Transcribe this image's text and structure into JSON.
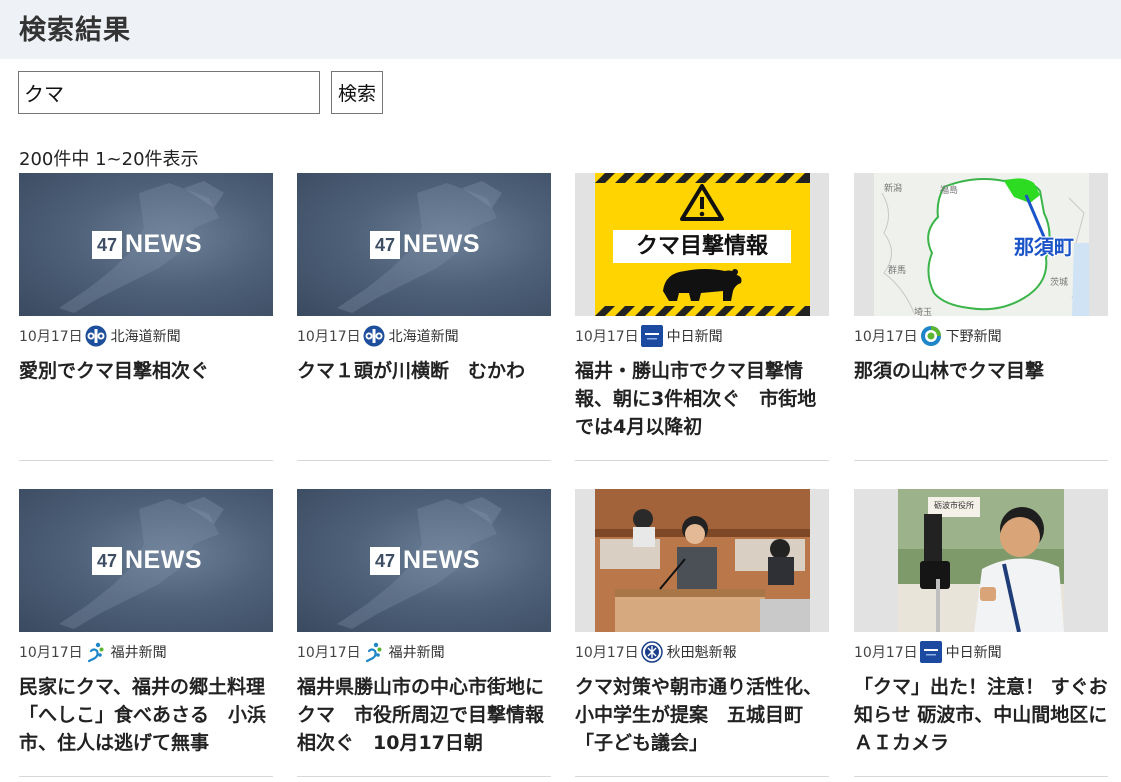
{
  "page": {
    "title": "検索結果"
  },
  "search": {
    "value": "クマ",
    "button_label": "検索"
  },
  "results": {
    "count_text": "200件中 1~20件表示",
    "items": [
      {
        "date": "10月17日",
        "source": "北海道新聞",
        "title": "愛別でクマ目撃相次ぐ",
        "thumb": "47news"
      },
      {
        "date": "10月17日",
        "source": "北海道新聞",
        "title": "クマ１頭が川横断　むかわ",
        "thumb": "47news"
      },
      {
        "date": "10月17日",
        "source": "中日新聞",
        "title": "福井・勝山市でクマ目撃情報、朝に3件相次ぐ　市街地では4月以降初",
        "thumb": "warning",
        "thumb_text": "クマ目撃情報"
      },
      {
        "date": "10月17日",
        "source": "下野新聞",
        "title": "那須の山林でクマ目撃",
        "thumb": "map",
        "map_labels": {
          "town": "那須町",
          "l1": "新潟",
          "l2": "福島",
          "l3": "群馬",
          "l4": "茨城",
          "l5": "埼玉"
        }
      },
      {
        "date": "10月17日",
        "source": "福井新聞",
        "title": "民家にクマ、福井の郷土料理「へしこ」食べあさる　小浜市、住人は逃げて無事",
        "thumb": "47news"
      },
      {
        "date": "10月17日",
        "source": "福井新聞",
        "title": "福井県勝山市の中心市街地にクマ　市役所周辺で目撃情報相次ぐ　10月17日朝",
        "thumb": "47news"
      },
      {
        "date": "10月17日",
        "source": "秋田魁新報",
        "title": "クマ対策や朝市通り活性化、小中学生が提案　五城目町「子ども議会」",
        "thumb": "photo-council"
      },
      {
        "date": "10月17日",
        "source": "中日新聞",
        "title": "「クマ」出た！注意！ すぐお知らせ 砺波市、中山間地区にＡＩカメラ",
        "thumb": "photo-camera",
        "sign_text": "砺波市役所"
      }
    ]
  },
  "thumb_47": {
    "box_text": "47",
    "word_text": "NEWS"
  },
  "colors": {
    "header_bg": "#eef1f5",
    "warning_yellow": "#ffd400",
    "map_green": "#3bb54a",
    "chunichi_blue": "#1c4aa0"
  }
}
